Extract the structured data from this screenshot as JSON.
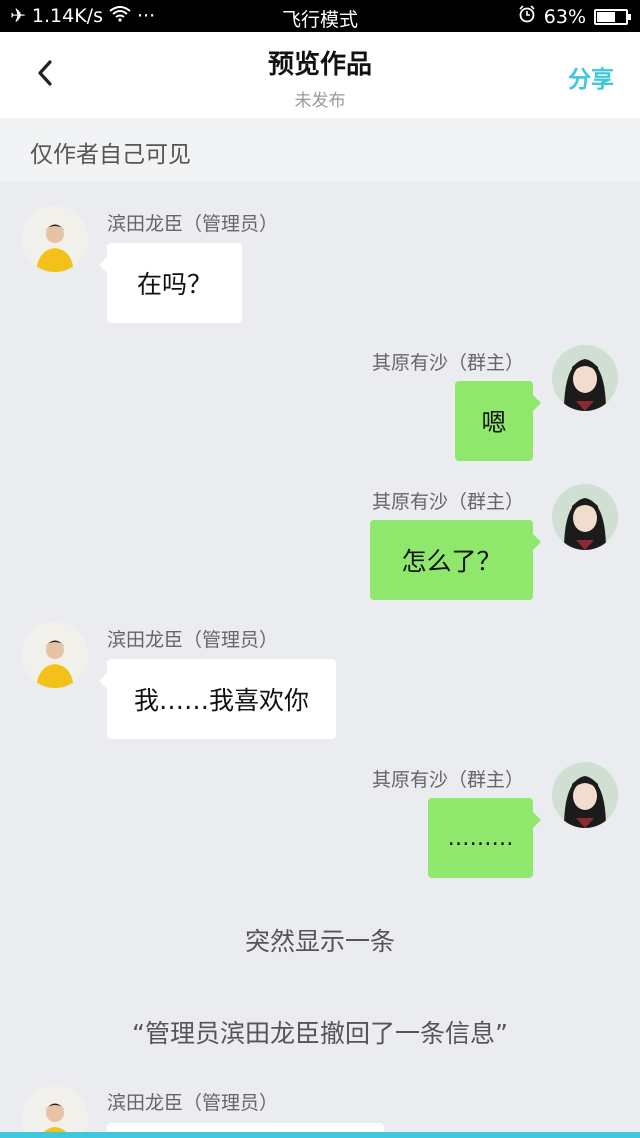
{
  "status_bar": {
    "speed": "1.14K/s",
    "dots": "···",
    "mode": "飞行模式",
    "battery": "63%",
    "battery_level": 0.63
  },
  "header": {
    "title": "预览作品",
    "subtitle": "未发布",
    "share": "分享"
  },
  "visibility_note": "仅作者自己可见",
  "messages": [
    {
      "side": "left",
      "name": "滨田龙臣（管理员）",
      "text": "在吗？"
    },
    {
      "side": "right",
      "name": "其原有沙（群主）",
      "text": "嗯"
    },
    {
      "side": "right",
      "name": "其原有沙（群主）",
      "text": "怎么了？"
    },
    {
      "side": "left",
      "name": "滨田龙臣（管理员）",
      "text": "我……我喜欢你"
    },
    {
      "side": "right",
      "name": "其原有沙（群主）",
      "text": "………"
    }
  ],
  "captions": [
    "突然显示一条",
    "“管理员滨田龙臣撤回了一条信息”"
  ],
  "last_message": {
    "side": "left",
    "name": "滨田龙臣（管理员）"
  },
  "colors": {
    "accent": "#3fc7dc",
    "right_bubble": "#8fe86c",
    "background": "#ebecf0"
  }
}
